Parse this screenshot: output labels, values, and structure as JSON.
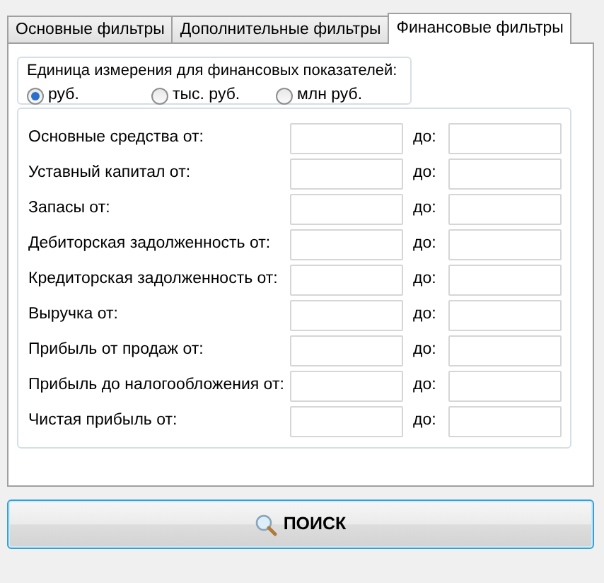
{
  "tabs": [
    {
      "label": "Основные фильтры",
      "selected": false
    },
    {
      "label": "Дополнительные фильтры",
      "selected": false
    },
    {
      "label": "Финансовые фильтры",
      "selected": true
    }
  ],
  "unit_group": {
    "title": "Единица измерения для финансовых показателей:",
    "options": [
      {
        "label": "руб.",
        "selected": true
      },
      {
        "label": "тыс. руб.",
        "selected": false
      },
      {
        "label": "млн руб.",
        "selected": false
      }
    ]
  },
  "filters": [
    {
      "label": "Основные средства от:",
      "to_label": "до:"
    },
    {
      "label": "Уставный капитал от:",
      "to_label": "до:"
    },
    {
      "label": "Запасы от:",
      "to_label": "до:"
    },
    {
      "label": "Дебиторская задолженность от:",
      "to_label": "до:"
    },
    {
      "label": "Кредиторская задолженность от:",
      "to_label": "до:"
    },
    {
      "label": "Выручка от:",
      "to_label": "до:"
    },
    {
      "label": "Прибыль от продаж от:",
      "to_label": "до:"
    },
    {
      "label": "Прибыль до налогообложения от:",
      "to_label": "до:"
    },
    {
      "label": "Чистая прибыль от:",
      "to_label": "до:"
    }
  ],
  "search_button": {
    "label": "ПОИСК"
  }
}
